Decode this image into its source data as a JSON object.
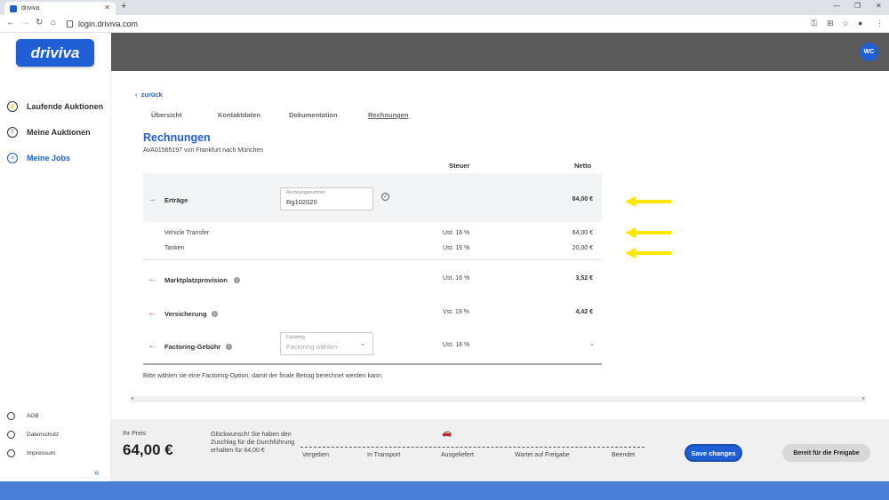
{
  "browser": {
    "tab_title": "driviva",
    "url": "login.driviva.com"
  },
  "brand": {
    "logo_text": "driviva",
    "primary_color": "#1f5fd6"
  },
  "user": {
    "initials": "WC"
  },
  "sidebar": {
    "items": [
      {
        "label": "Laufende Auktionen",
        "icon": "gavel-icon"
      },
      {
        "label": "Meine Auktionen",
        "icon": "auction-icon"
      },
      {
        "label": "Meine Jobs",
        "icon": "jobs-icon"
      }
    ],
    "footer": [
      {
        "label": "AGB",
        "icon": "dollar-icon"
      },
      {
        "label": "Datenschutz",
        "icon": "privacy-icon"
      },
      {
        "label": "Impressum",
        "icon": "info-icon"
      }
    ]
  },
  "page": {
    "back_label": "zurück",
    "tabs": [
      "Übersicht",
      "Kontaktdaten",
      "Dokumentation",
      "Rechnungen"
    ],
    "title": "Rechnungen",
    "subtitle": "AVA01565197 von Frankfurt nach München",
    "col_tax": "Steuer",
    "col_net": "Netto"
  },
  "rows": {
    "ertraege": {
      "label": "Erträge",
      "field_label": "Rechnungsnummer",
      "field_value": "Rg102020",
      "net": "84,00 €"
    },
    "vehicle": {
      "label": "Vehicle Transfer",
      "tax": "Ust. 16 %",
      "net": "64,00 €"
    },
    "tanken": {
      "label": "Tanken",
      "tax": "Ust. 16 %",
      "net": "20,00 €"
    },
    "markt": {
      "label": "Marktplatzprovision",
      "tax": "Ust. 16 %",
      "net": "3,52 €"
    },
    "vers": {
      "label": "Versicherung",
      "tax": "Vst. 19 %",
      "net": "4,42 €"
    },
    "factoring": {
      "label": "Factoring-Gebühr",
      "field_label": "Factoring",
      "placeholder": "Factoring wählen",
      "tax": "Ust. 16 %",
      "net": "-"
    }
  },
  "note": "Bitte wählen sie eine Factoring-Option, damit der finale Betrag berechnet werden kann.",
  "footer": {
    "price_label": "Ihr Preis",
    "price": "64,00 €",
    "congrats": "Glückwunsch! Sie haben den Zuschlag für die Durchführung erhalten für 64,00 €",
    "stages": [
      "Vergeben",
      "In Transport",
      "Ausgeliefert",
      "Wartet auf Freigabe",
      "Beendet"
    ],
    "save_label": "Save changes",
    "ready_label": "Bereit für die Freigabe"
  }
}
